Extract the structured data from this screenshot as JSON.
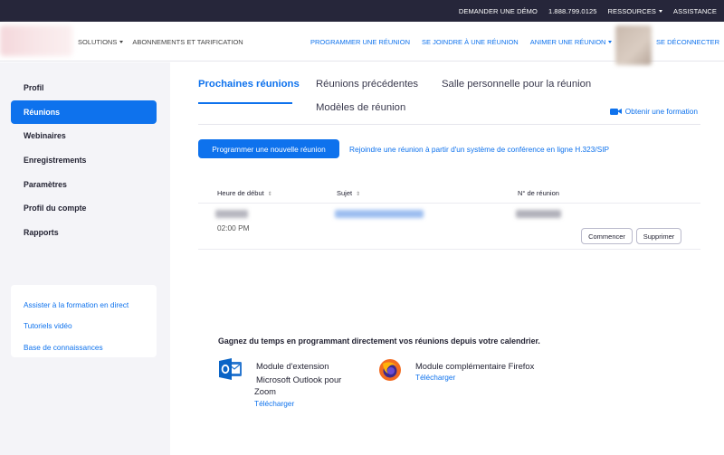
{
  "topbar": {
    "demo": "DEMANDER UNE DÉMO",
    "phone": "1.888.799.0125",
    "resources": "RESSOURCES",
    "support": "ASSISTANCE"
  },
  "header": {
    "solutions": "SOLUTIONS",
    "plans": "ABONNEMENTS ET TARIFICATION",
    "schedule": "PROGRAMMER UNE RÉUNION",
    "join": "SE JOINDRE À UNE RÉUNION",
    "host": "ANIMER UNE RÉUNION",
    "logout": "SE DÉCONNECTER"
  },
  "sidebar": {
    "items": [
      {
        "label": "Profil"
      },
      {
        "label": "Réunions"
      },
      {
        "label": "Webinaires"
      },
      {
        "label": "Enregistrements"
      },
      {
        "label": "Paramètres"
      },
      {
        "label": "Profil du compte"
      },
      {
        "label": "Rapports"
      }
    ],
    "help": [
      {
        "label": "Assister à la formation en direct"
      },
      {
        "label": "Tutoriels vidéo"
      },
      {
        "label": "Base de connaissances"
      }
    ]
  },
  "tabs": {
    "upcoming": "Prochaines réunions",
    "previous": "Réunions précédentes",
    "personal_room": "Salle personnelle pour la réunion",
    "templates": "Modèles de réunion",
    "training": "Obtenir une formation"
  },
  "actions": {
    "schedule_new": "Programmer une nouvelle réunion",
    "join_h323": "Rejoindre une réunion à partir d'un système de conférence en ligne H.323/SIP"
  },
  "table": {
    "headers": {
      "start_time": "Heure de début",
      "topic": "Sujet",
      "meeting_id": "N° de réunion"
    },
    "rows": [
      {
        "time": "02:00 PM",
        "start_label": "Commencer",
        "delete_label": "Supprimer"
      }
    ]
  },
  "calendar": {
    "title": "Gagnez du temps en programmant directement vos réunions depuis votre calendrier.",
    "outlook_line1": "Module d'extension",
    "outlook_line2": "Microsoft Outlook pour",
    "outlook_line3": "Zoom",
    "outlook_download": "Télécharger",
    "firefox_name": "Module complémentaire Firefox",
    "firefox_download": "Télécharger"
  },
  "colors": {
    "accent": "#0e72ed",
    "topbar_bg": "#26263a",
    "sidebar_bg": "#f4f4f8"
  }
}
